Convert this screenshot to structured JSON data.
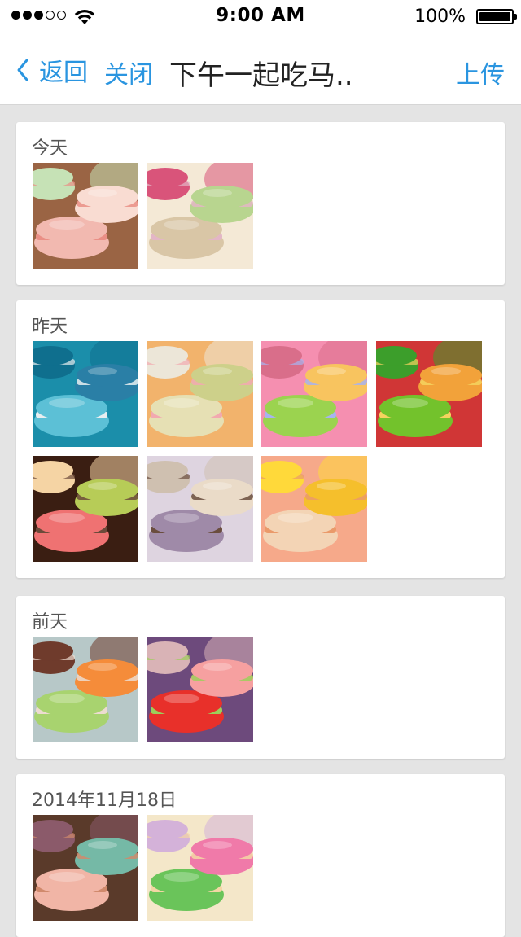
{
  "status_bar": {
    "time": "9:00 AM",
    "battery": "100%",
    "signal_full": 3,
    "signal_total": 5
  },
  "nav": {
    "back_label": "返回",
    "close_label": "关闭",
    "title": "下午一起吃马..",
    "upload_label": "上传",
    "accent_color": "#2a95e0"
  },
  "sections": [
    {
      "title": "今天",
      "photos": [
        {
          "name": "macaron-pink-stack",
          "colors": [
            "#9a6444",
            "#f2b9b0",
            "#f9dcd2",
            "#ea8f86",
            "#c6e2b6"
          ]
        },
        {
          "name": "macaron-pastel-tower",
          "colors": [
            "#f4e9d6",
            "#d9c6a6",
            "#b8d58f",
            "#e3b6c6",
            "#d9547a"
          ]
        }
      ]
    },
    {
      "title": "昨天",
      "photos": [
        {
          "name": "macaron-blue",
          "colors": [
            "#1b8eaa",
            "#5cc0d6",
            "#2a7fa6",
            "#e8eef0",
            "#0f6f8e"
          ]
        },
        {
          "name": "macaron-pistachio-pink",
          "colors": [
            "#f2b36c",
            "#e6e0b4",
            "#cdd08a",
            "#f2a9b0",
            "#ece6d8"
          ]
        },
        {
          "name": "macaron-rainbow-rows",
          "colors": [
            "#f58fb0",
            "#9bd34f",
            "#f8c45f",
            "#a7b3ef",
            "#d96e8a"
          ]
        },
        {
          "name": "macaron-green-red",
          "colors": [
            "#d03636",
            "#73c22c",
            "#f2a23a",
            "#f5d35f",
            "#3c9e2b"
          ]
        }
      ]
    },
    {
      "title": "",
      "photos": [
        {
          "name": "macaron-dark-box",
          "colors": [
            "#3a1e12",
            "#ef7272",
            "#b7cc57",
            "#6c4a3a",
            "#f5d4a4"
          ]
        },
        {
          "name": "macaron-lavender-cream",
          "colors": [
            "#ded4e0",
            "#9f8aa8",
            "#eadbc8",
            "#6a4d3e",
            "#cfc0b0"
          ]
        },
        {
          "name": "macaron-peach-yellow",
          "colors": [
            "#f6a98a",
            "#f3d4b5",
            "#f5bf2c",
            "#ea9a6a",
            "#ffd93a"
          ]
        }
      ]
    },
    {
      "title": "前天",
      "photos": [
        {
          "name": "macaron-green-orange-choc",
          "colors": [
            "#b7c8c8",
            "#a8d36f",
            "#f58c3a",
            "#ecdcd0",
            "#6f3b2c"
          ]
        },
        {
          "name": "macaron-purple-red",
          "colors": [
            "#6d4a7c",
            "#e8302a",
            "#f6a0a0",
            "#9ccf5a",
            "#d9b3b6"
          ]
        }
      ]
    },
    {
      "title": "2014年11月18日",
      "photos": [
        {
          "name": "macaron-mixed-stack",
          "colors": [
            "#5a3a2a",
            "#f1b5a6",
            "#75b9a6",
            "#d0896c",
            "#8b5a6a"
          ]
        },
        {
          "name": "macaron-decorated",
          "colors": [
            "#f4e7c9",
            "#6ac45a",
            "#f07aa9",
            "#f3d6a4",
            "#d4b2d9"
          ]
        }
      ]
    }
  ]
}
